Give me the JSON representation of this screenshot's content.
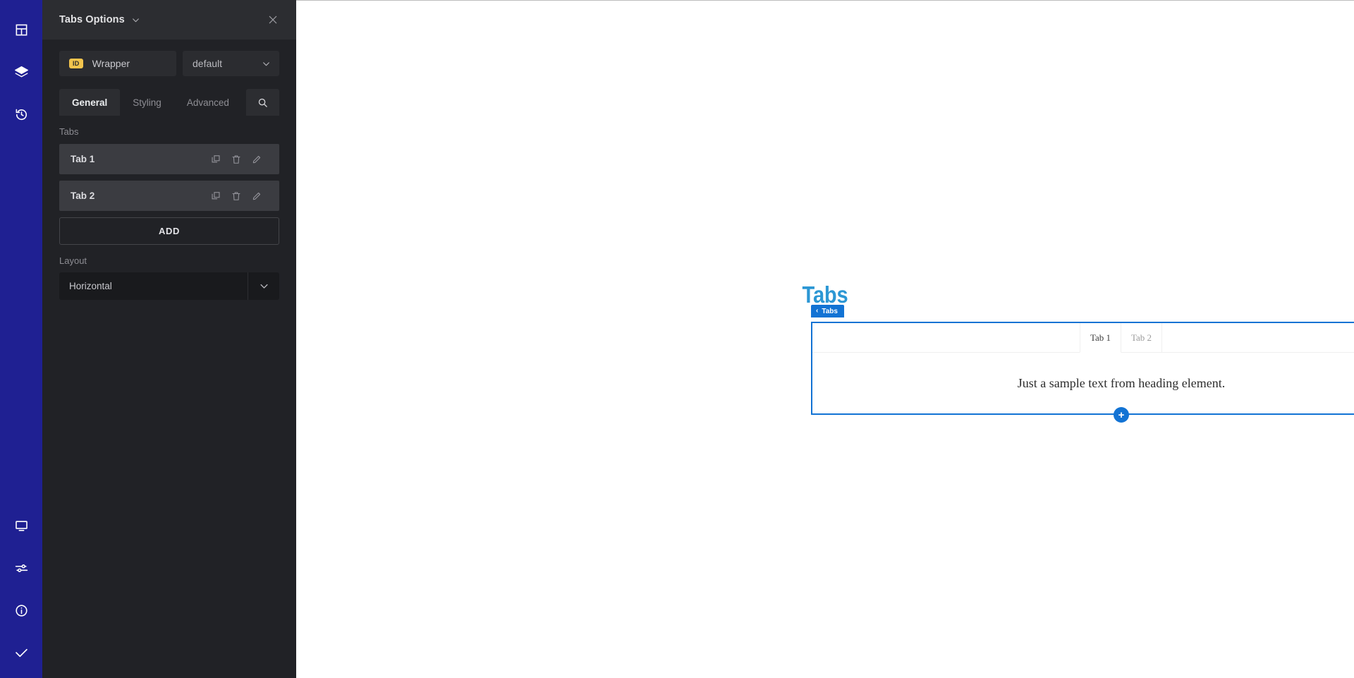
{
  "rail": {
    "top_items": [
      {
        "name": "layout-grid-icon",
        "label": "Layout"
      },
      {
        "name": "layers-icon",
        "label": "Layers"
      },
      {
        "name": "history-icon",
        "label": "History"
      }
    ],
    "bottom_items": [
      {
        "name": "responsive-monitor-icon",
        "label": "Responsive"
      },
      {
        "name": "sliders-settings-icon",
        "label": "Settings"
      },
      {
        "name": "info-circle-icon",
        "label": "Info"
      },
      {
        "name": "checkmark-icon",
        "label": "Done"
      }
    ],
    "background_color": "#1f2092"
  },
  "panel": {
    "title": "Tabs Options",
    "title_chevron": "chevron-down-icon",
    "close_icon": "close-icon",
    "id_field": {
      "badge": "ID",
      "value": "Wrapper",
      "badge_color": "#f2c44d"
    },
    "style_select": {
      "value": "default",
      "chevron": "chevron-down-icon"
    },
    "tabs": [
      {
        "label": "General",
        "active": true
      },
      {
        "label": "Styling",
        "active": false
      },
      {
        "label": "Advanced",
        "active": false
      }
    ],
    "search_icon": "search-icon",
    "sections": {
      "tabs_label": "Tabs",
      "items": [
        {
          "label": "Tab 1",
          "actions": [
            "duplicate-icon",
            "delete-icon",
            "edit-icon"
          ]
        },
        {
          "label": "Tab 2",
          "actions": [
            "duplicate-icon",
            "delete-icon",
            "edit-icon"
          ]
        }
      ],
      "add_button": "ADD",
      "layout_label": "Layout",
      "layout_value": "Horizontal",
      "layout_chevron": "chevron-down-icon"
    }
  },
  "canvas": {
    "page_heading": "Tabs",
    "heading_color": "#2c97d4",
    "selection_badge": {
      "chevron": "‹",
      "label": "Tabs",
      "color": "#1273d4"
    },
    "widget": {
      "tabs": [
        {
          "label": "Tab 1",
          "active": true
        },
        {
          "label": "Tab 2",
          "active": false
        }
      ],
      "content_text": "Just a sample text from heading element.",
      "add_button": "+",
      "border_color": "#1273d4"
    }
  }
}
